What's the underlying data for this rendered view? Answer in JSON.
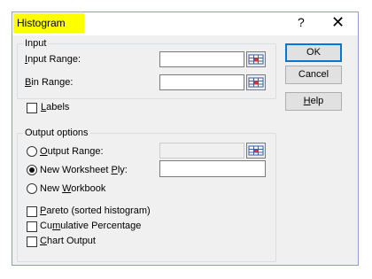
{
  "dialog": {
    "title": "Histogram",
    "help_glyph": "?",
    "close_glyph": "✕",
    "highlight_color": "#ffff00"
  },
  "input": {
    "legend": "Input",
    "input_range": {
      "underlined": "I",
      "rest": "nput Range:",
      "value": ""
    },
    "bin_range": {
      "underlined": "B",
      "rest": "in Range:",
      "value": ""
    },
    "labels": {
      "underlined": "L",
      "rest": "abels",
      "checked": false
    }
  },
  "output": {
    "legend": "Output options",
    "output_range": {
      "underlined": "O",
      "rest": "utput Range:",
      "selected": false,
      "value": ""
    },
    "new_ply": {
      "before": "New Worksheet ",
      "underlined": "P",
      "after": "ly:",
      "selected": true,
      "value": ""
    },
    "new_workbook": {
      "before": "New ",
      "underlined": "W",
      "after": "orkbook",
      "selected": false
    },
    "pareto": {
      "underlined": "P",
      "rest": "areto (sorted histogram)",
      "checked": false
    },
    "cumulative": {
      "before": "Cu",
      "underlined": "m",
      "after": "ulative Percentage",
      "checked": false
    },
    "chart": {
      "underlined": "C",
      "rest": "hart Output",
      "checked": false
    }
  },
  "buttons": {
    "ok": "OK",
    "cancel": "Cancel",
    "help": {
      "underlined": "H",
      "rest": "elp"
    }
  },
  "icons": {
    "range_select": "range-select-icon"
  }
}
